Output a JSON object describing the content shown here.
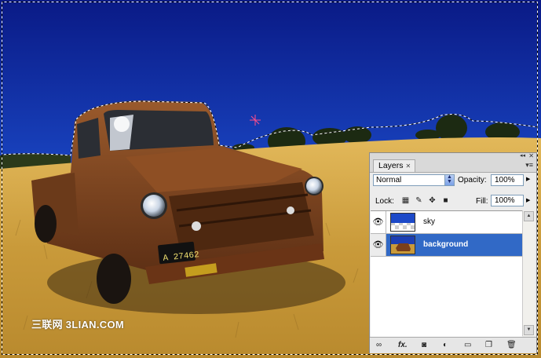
{
  "watermark": "三联网 3LIAN.COM",
  "license_plate": "A 27462",
  "layers_panel": {
    "tab_label": "Layers",
    "blend_mode": "Normal",
    "opacity_label": "Opacity:",
    "opacity_value": "100%",
    "lock_label": "Lock:",
    "fill_label": "Fill:",
    "fill_value": "100%",
    "layers": [
      {
        "name": "sky",
        "visible": true,
        "selected": false
      },
      {
        "name": "background",
        "visible": true,
        "selected": true
      }
    ],
    "footer_buttons": [
      "link-layers",
      "fx",
      "add-mask",
      "adjustment-layer",
      "new-group",
      "new-layer",
      "delete-layer"
    ],
    "fx_label": "fx."
  },
  "colors": {
    "selection_highlight": "#3169c6",
    "sky_top": "#0a1f8f",
    "sky_bottom": "#2f74e0",
    "grass": "#c99a3a"
  }
}
